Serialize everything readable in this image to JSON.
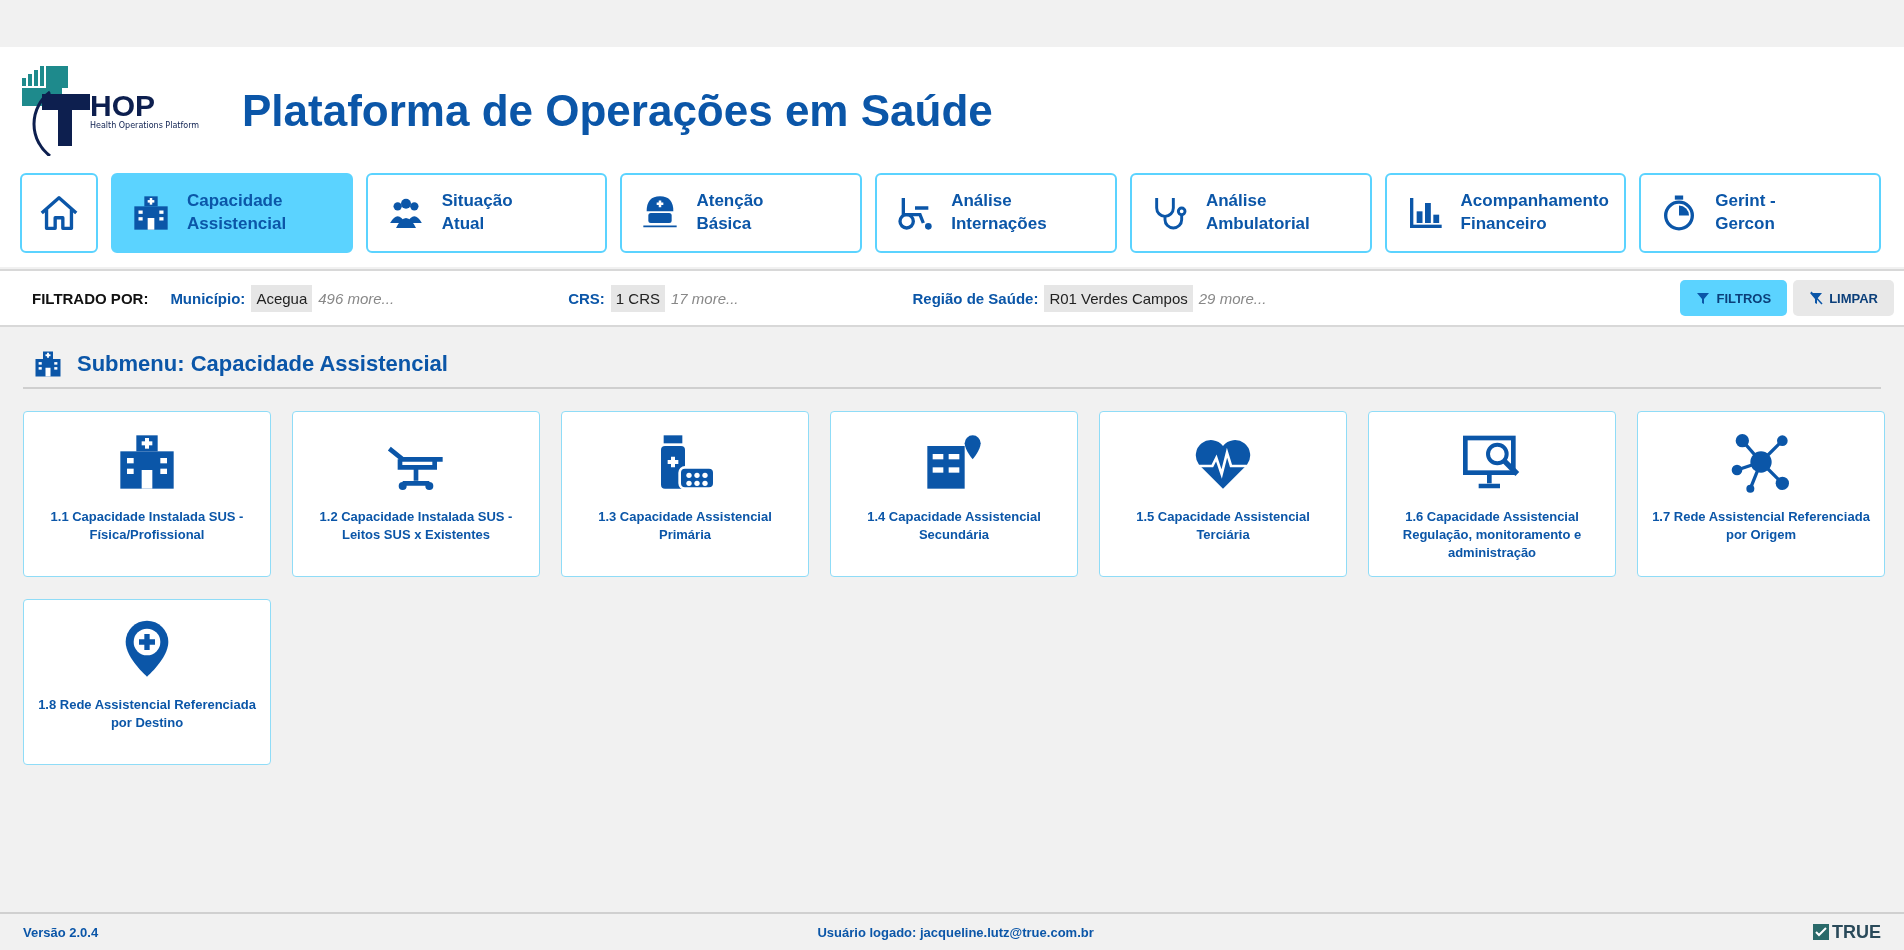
{
  "logo": {
    "mark": "HOP",
    "tagline": "Health Operations Platform"
  },
  "title": "Plataforma de Operações em Saúde",
  "tabs": [
    {
      "kind": "home",
      "selected": false
    },
    {
      "label": "Capacidade Assistencial",
      "kind": "section",
      "selected": true
    },
    {
      "label": "Situação Atual",
      "kind": "section",
      "selected": false
    },
    {
      "label": "Atenção Básica",
      "kind": "section",
      "selected": false
    },
    {
      "label": "Análise Internações",
      "kind": "section",
      "selected": false
    },
    {
      "label": "Análise Ambulatorial",
      "kind": "section",
      "selected": false
    },
    {
      "label": "Acompanhamento Financeiro",
      "kind": "section",
      "selected": false
    },
    {
      "label": "Gerint - Gercon",
      "kind": "section",
      "selected": false
    }
  ],
  "filter_bar": {
    "label": "FILTRADO POR:",
    "filters": [
      {
        "name": "Município:",
        "value": "Acegua",
        "more": "496 more..."
      },
      {
        "name": "CRS:",
        "value": "1 CRS",
        "more": "17 more..."
      },
      {
        "name": "Região de Saúde:",
        "value": "R01 Verdes Campos",
        "more": "29 more..."
      }
    ],
    "buttons": [
      {
        "label": "FILTROS",
        "selected": true
      },
      {
        "label": "LIMPAR",
        "selected": false
      }
    ]
  },
  "submenu_title": "Submenu: Capacidade Assistencial",
  "cards": [
    {
      "label": "1.1 Capacidade Instalada SUS - Física/Profissional"
    },
    {
      "label": "1.2 Capacidade Instalada SUS - Leitos SUS x Existentes"
    },
    {
      "label": "1.3 Capacidade Assistencial Primária"
    },
    {
      "label": "1.4 Capacidade Assistencial Secundária"
    },
    {
      "label": "1.5 Capacidade Assistencial Terciária"
    },
    {
      "label": "1.6 Capacidade Assistencial Regulação, monitoramento e administração"
    },
    {
      "label": "1.7 Rede Assistencial Referenciada por Origem"
    },
    {
      "label": "1.8 Rede Assistencial Referenciada por Destino"
    }
  ],
  "footer": {
    "version": "Versão 2.0.4",
    "user": "Usuário logado: jacqueline.lutz@true.com.br",
    "brand": "TRUE"
  }
}
